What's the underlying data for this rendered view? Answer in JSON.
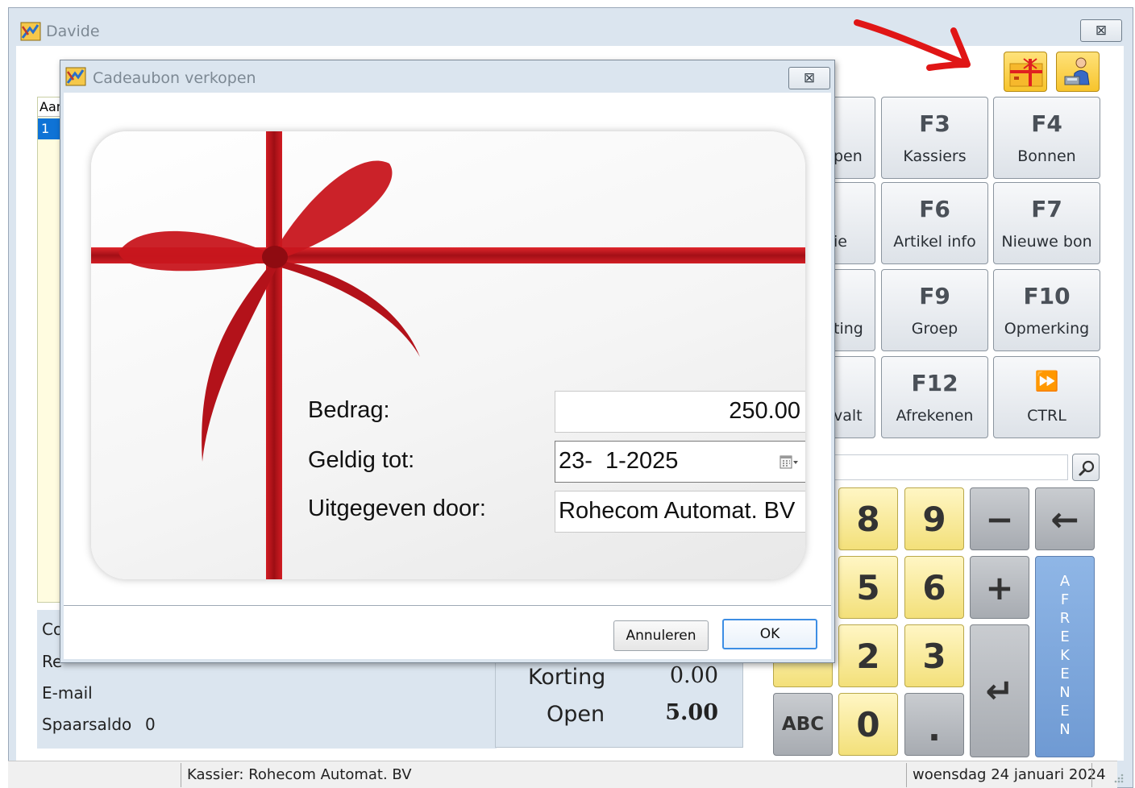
{
  "main_window": {
    "title": "Davide",
    "close_glyph": "⊠"
  },
  "list": {
    "header": "Aantal",
    "selected_value": "1"
  },
  "customer": {
    "company_label": "Co",
    "relation_label": "Re",
    "email_label": "E-mail",
    "savings_label": "Spaarsaldo",
    "savings_value": "0"
  },
  "totals": {
    "discount_label": "Korting",
    "discount_value": "0.00",
    "open_label": "Open",
    "open_value": "5.00"
  },
  "status": {
    "cashier": "Kassier: Rohecom Automat. BV",
    "date": "woensdag 24 januari 2024"
  },
  "function_keys": {
    "row1": [
      {
        "key": "",
        "label": "pen"
      },
      {
        "key": "F3",
        "label": "Kassiers"
      },
      {
        "key": "F4",
        "label": "Bonnen"
      }
    ],
    "row2": [
      {
        "key": "",
        "label": "ie"
      },
      {
        "key": "F6",
        "label": "Artikel info"
      },
      {
        "key": "F7",
        "label": "Nieuwe bon"
      }
    ],
    "row3": [
      {
        "key": "",
        "label": "ting"
      },
      {
        "key": "F9",
        "label": "Groep"
      },
      {
        "key": "F10",
        "label": "Opmerking"
      }
    ],
    "row4": [
      {
        "key": "",
        "label": "valt"
      },
      {
        "key": "F12",
        "label": "Afrekenen"
      },
      {
        "key": "⏩",
        "label": "CTRL"
      }
    ]
  },
  "toolbar_icons": [
    "gift-card-icon",
    "cashier-person-icon"
  ],
  "numpad": {
    "k8": "8",
    "k9": "9",
    "minus": "−",
    "backspace": "←",
    "k5": "5",
    "k6": "6",
    "plus": "+",
    "k2": "2",
    "k3": "3",
    "enter": "↵",
    "abc": "ABC",
    "k0": "0",
    "dot": ".",
    "afrekenen_letters": [
      "A",
      "F",
      "R",
      "E",
      "K",
      "E",
      "N",
      "E",
      "N"
    ]
  },
  "colors": {
    "afrekenen": "#7aa4db",
    "ribbon": "#c0141d",
    "key_yellow": "#f6e690"
  },
  "dialog": {
    "title": "Cadeaubon verkopen",
    "close_glyph": "⊠",
    "amount_label": "Bedrag:",
    "amount_value": "250.00",
    "valid_label": "Geldig tot:",
    "valid_value": "23-  1-2025",
    "issued_label": "Uitgegeven door:",
    "issued_value": "Rohecom Automat. BV",
    "cancel_label": "Annuleren",
    "ok_label": "OK"
  }
}
